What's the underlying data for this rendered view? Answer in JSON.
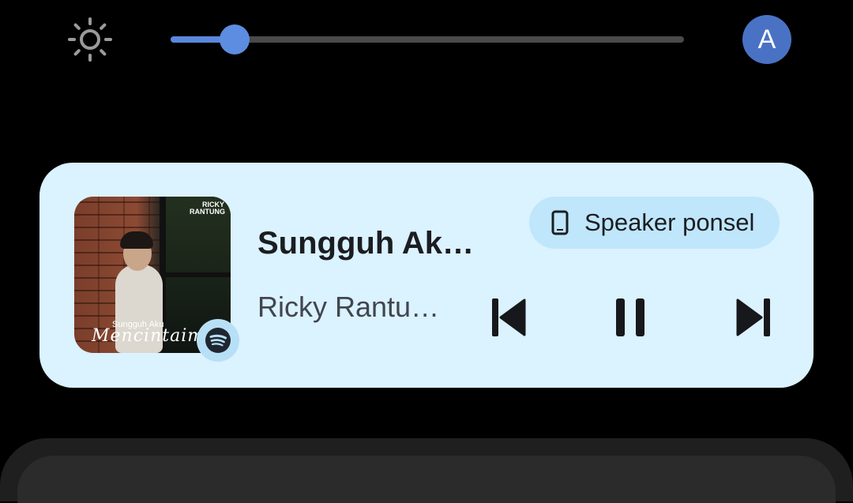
{
  "quick_settings": {
    "brightness_icon": "sun-icon",
    "brightness_level": 0.125,
    "avatar_letter": "A",
    "accent_color": "#5d8de0"
  },
  "media_player": {
    "song_title": "Sungguh Ak…",
    "artist": "Ricky Rantu…",
    "output_device": "Speaker ponsel",
    "output_icon": "phone-icon",
    "app_icon": "spotify-icon",
    "album_art": {
      "artist_text": "RICKY RANTUNG",
      "subtitle_text": "Sungguh Aku",
      "title_text": "Mencintaimu"
    },
    "controls": {
      "previous_icon": "skip-previous-icon",
      "play_pause_icon": "pause-icon",
      "next_icon": "skip-next-icon"
    },
    "card_color": "#dbf2ff"
  }
}
